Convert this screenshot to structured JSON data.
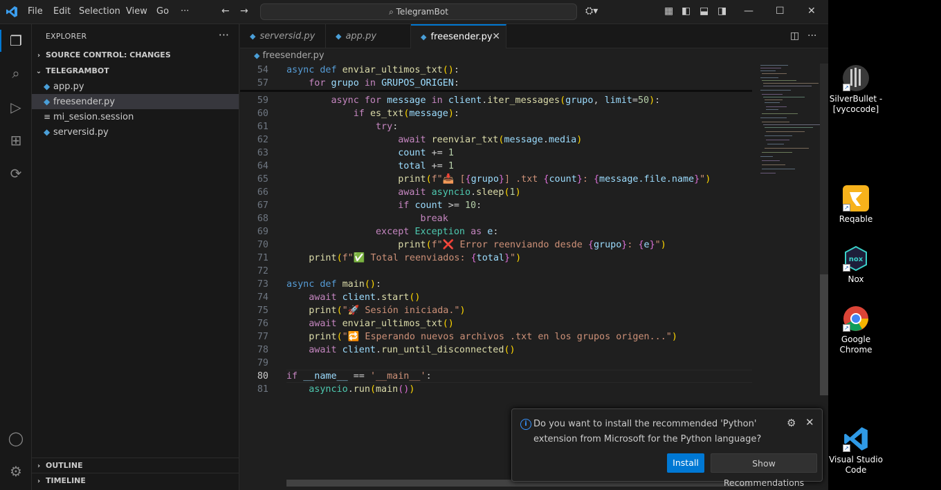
{
  "titlebar": {
    "menus": [
      "File",
      "Edit",
      "Selection",
      "View",
      "Go",
      "···"
    ],
    "search": "TelegramBot"
  },
  "sidebar": {
    "header": "EXPLORER",
    "source_control": "SOURCE CONTROL: CHANGES",
    "project": "TELEGRAMBOT",
    "files": [
      "app.py",
      "freesender.py",
      "mi_sesion.session",
      "serversid.py"
    ],
    "outline": "OUTLINE",
    "timeline": "TIMELINE"
  },
  "tabs": [
    "serversid.py",
    "app.py",
    "freesender.py"
  ],
  "breadcrumb": "freesender.py",
  "code": {
    "lines": [
      {
        "n": "54",
        "sticky": true
      },
      {
        "n": "57",
        "sticky": true
      },
      {
        "n": "59"
      },
      {
        "n": "60"
      },
      {
        "n": "61"
      },
      {
        "n": "62"
      },
      {
        "n": "63"
      },
      {
        "n": "64"
      },
      {
        "n": "65"
      },
      {
        "n": "66"
      },
      {
        "n": "67"
      },
      {
        "n": "68"
      },
      {
        "n": "69"
      },
      {
        "n": "70"
      },
      {
        "n": "71"
      },
      {
        "n": "72"
      },
      {
        "n": "73"
      },
      {
        "n": "74"
      },
      {
        "n": "75"
      },
      {
        "n": "76"
      },
      {
        "n": "77"
      },
      {
        "n": "78"
      },
      {
        "n": "79"
      },
      {
        "n": "80"
      },
      {
        "n": "81"
      }
    ],
    "text": {
      "l54a": "async",
      "l54b": "def",
      "l54c": "enviar_ultimos_txt",
      "l57a": "for",
      "l57b": "grupo",
      "l57c": "in",
      "l57d": "GRUPOS_ORIGEN",
      "l59a": "async",
      "l59b": "for",
      "l59c": "message",
      "l59d": "in",
      "l59e": "client",
      "l59f": "iter_messages",
      "l59g": "grupo",
      "l59h": "limit",
      "l59i": "50",
      "l60a": "if",
      "l60b": "es_txt",
      "l60c": "message",
      "l61a": "try",
      "l62a": "await",
      "l62b": "reenviar_txt",
      "l62c": "message",
      "l62d": "media",
      "l63a": "count",
      "l63b": "1",
      "l64a": "total",
      "l64b": "1",
      "l65a": "print",
      "l65b": "f\"📥 [",
      "l65c": "grupo",
      "l65d": "] .txt ",
      "l65e": "count",
      "l65f": ": ",
      "l65g": "message.file.name",
      "l65h": "\"",
      "l66a": "await",
      "l66b": "asyncio",
      "l66c": "sleep",
      "l66d": "1",
      "l67a": "if",
      "l67b": "count",
      "l67c": "10",
      "l68a": "break",
      "l69a": "except",
      "l69b": "Exception",
      "l69c": "as",
      "l69d": "e",
      "l70a": "print",
      "l70b": "f\"❌ Error reenviando desde ",
      "l70c": "grupo",
      "l70d": ": ",
      "l70e": "e",
      "l70f": "\"",
      "l71a": "print",
      "l71b": "f\"✅ Total reenviados: ",
      "l71c": "total",
      "l71d": "\"",
      "l73a": "async",
      "l73b": "def",
      "l73c": "main",
      "l74a": "await",
      "l74b": "client",
      "l74c": "start",
      "l75a": "print",
      "l75b": "\"🚀 Sesión iniciada.\"",
      "l76a": "await",
      "l76b": "enviar_ultimos_txt",
      "l77a": "print",
      "l77b": "\"🔁 Esperando nuevos archivos .txt en los grupos origen...\"",
      "l78a": "await",
      "l78b": "client",
      "l78c": "run_until_disconnected",
      "l80a": "if",
      "l80b": "__name__",
      "l80c": "'__main__'",
      "l81a": "asyncio",
      "l81b": "run",
      "l81c": "main"
    }
  },
  "notification": {
    "message": "Do you want to install the recommended 'Python' extension from Microsoft for the Python language?",
    "install": "Install",
    "show": "Show Recommendations"
  },
  "desktop": [
    {
      "label": "SilverBullet - [vycocode]"
    },
    {
      "label": "Reqable"
    },
    {
      "label": "Nox"
    },
    {
      "label": "Google Chrome"
    },
    {
      "label": "Visual Studio Code"
    }
  ]
}
